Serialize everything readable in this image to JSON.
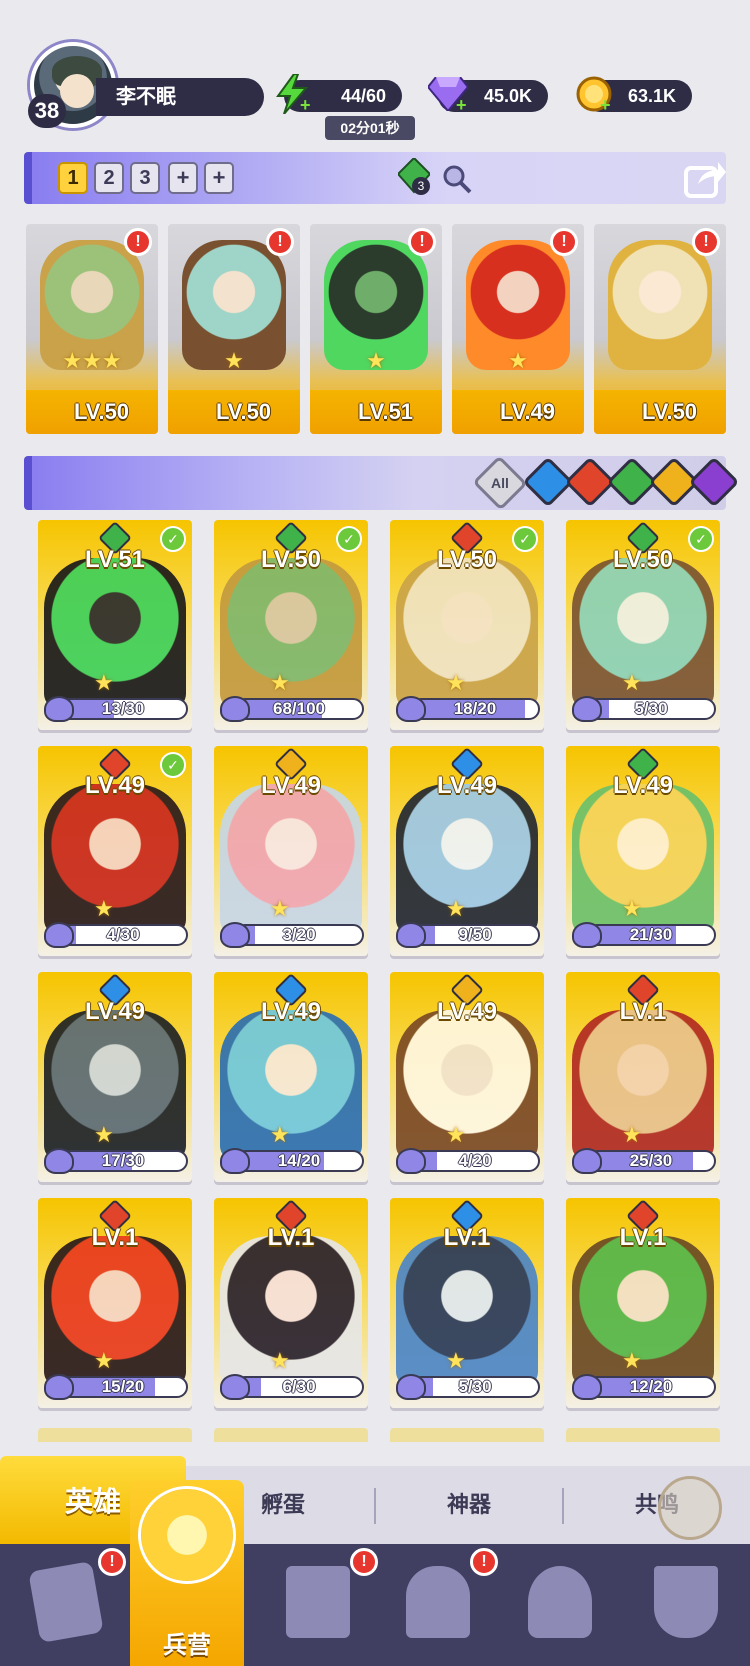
{
  "player": {
    "name": "李不眠",
    "level": "38"
  },
  "resources": {
    "energy": "44/60",
    "energy_timer": "02分01秒",
    "gems": "45.0K",
    "gold": "63.1K"
  },
  "team_bar": {
    "slots": [
      "1",
      "2",
      "3",
      "+",
      "+"
    ],
    "active_slot": "1",
    "gem_count": "3"
  },
  "team": [
    {
      "level": "LV.50",
      "element": "wind",
      "stars": "★★★",
      "alert": "!"
    },
    {
      "level": "LV.50",
      "element": "wind",
      "stars": "★",
      "alert": "!"
    },
    {
      "level": "LV.51",
      "element": "wind",
      "stars": "★",
      "alert": "!"
    },
    {
      "level": "LV.49",
      "element": "fire",
      "stars": "★",
      "alert": "!"
    },
    {
      "level": "LV.50",
      "element": "fire",
      "stars": "",
      "alert": "!"
    }
  ],
  "filters": {
    "all_label": "All",
    "elements": [
      "water",
      "fire",
      "wind",
      "light",
      "dark"
    ]
  },
  "heroes": [
    {
      "level": "LV.51",
      "element": "wind",
      "shards": "13/30",
      "progress": 0.43,
      "checked": true,
      "star": "★"
    },
    {
      "level": "LV.50",
      "element": "wind",
      "shards": "68/100",
      "progress": 0.68,
      "checked": true,
      "star": "★"
    },
    {
      "level": "LV.50",
      "element": "fire",
      "shards": "18/20",
      "progress": 0.9,
      "checked": true,
      "star": "★"
    },
    {
      "level": "LV.50",
      "element": "wind",
      "shards": "5/30",
      "progress": 0.17,
      "checked": true,
      "star": "★"
    },
    {
      "level": "LV.49",
      "element": "fire",
      "shards": "4/30",
      "progress": 0.13,
      "checked": true,
      "star": "★"
    },
    {
      "level": "LV.49",
      "element": "light",
      "shards": "3/20",
      "progress": 0.15,
      "checked": false,
      "star": "★"
    },
    {
      "level": "LV.49",
      "element": "water",
      "shards": "9/50",
      "progress": 0.18,
      "checked": false,
      "star": "★"
    },
    {
      "level": "LV.49",
      "element": "wind",
      "shards": "21/30",
      "progress": 0.7,
      "checked": false,
      "star": "★"
    },
    {
      "level": "LV.49",
      "element": "water",
      "shards": "17/30",
      "progress": 0.57,
      "checked": false,
      "star": "★"
    },
    {
      "level": "LV.49",
      "element": "water",
      "shards": "14/20",
      "progress": 0.7,
      "checked": false,
      "star": "★"
    },
    {
      "level": "LV.49",
      "element": "light",
      "shards": "4/20",
      "progress": 0.2,
      "checked": false,
      "star": "★"
    },
    {
      "level": "LV.1",
      "element": "fire",
      "shards": "25/30",
      "progress": 0.83,
      "checked": false,
      "star": "★"
    },
    {
      "level": "LV.1",
      "element": "fire",
      "shards": "15/20",
      "progress": 0.75,
      "checked": false,
      "star": "★"
    },
    {
      "level": "LV.1",
      "element": "fire",
      "shards": "6/30",
      "progress": 0.2,
      "checked": false,
      "star": "★"
    },
    {
      "level": "LV.1",
      "element": "water",
      "shards": "5/30",
      "progress": 0.17,
      "checked": false,
      "star": "★"
    },
    {
      "level": "LV.1",
      "element": "fire",
      "shards": "12/20",
      "progress": 0.6,
      "checked": false,
      "star": "★"
    }
  ],
  "sub_tabs": {
    "heroes": "英雄",
    "hatch": "孵蛋",
    "artifact": "神器",
    "resonance": "共鸣"
  },
  "bottom_nav": {
    "barracks": "兵营"
  },
  "colors": {
    "wind": "#3fb34a",
    "fire": "#e0442a",
    "water": "#2e8fe6",
    "light": "#f0b21c",
    "dark": "#8b3fd0",
    "panel": "#2e2d45"
  }
}
